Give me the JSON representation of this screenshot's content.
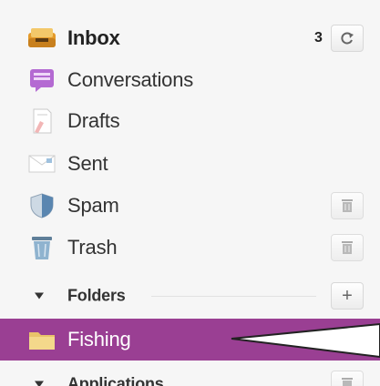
{
  "colors": {
    "selected_bg": "#9a3f93",
    "panel_bg": "#f6f6f6",
    "folder_yellow": "#e9c36a"
  },
  "mailboxes": [
    {
      "label": "Inbox",
      "icon": "inbox-tray-icon",
      "count": "3",
      "action": "refresh-icon",
      "bold": true
    },
    {
      "label": "Conversations",
      "icon": "conversations-icon"
    },
    {
      "label": "Drafts",
      "icon": "drafts-icon"
    },
    {
      "label": "Sent",
      "icon": "sent-icon"
    },
    {
      "label": "Spam",
      "icon": "shield-icon",
      "action": "empty-spam-icon"
    },
    {
      "label": "Trash",
      "icon": "trash-can-icon",
      "action": "empty-trash-icon"
    }
  ],
  "folders_section": {
    "label": "Folders",
    "add_symbol": "+"
  },
  "folders": [
    {
      "label": "Fishing",
      "icon": "folder-icon",
      "selected": true
    }
  ],
  "applications_section": {
    "label": "Applications"
  }
}
